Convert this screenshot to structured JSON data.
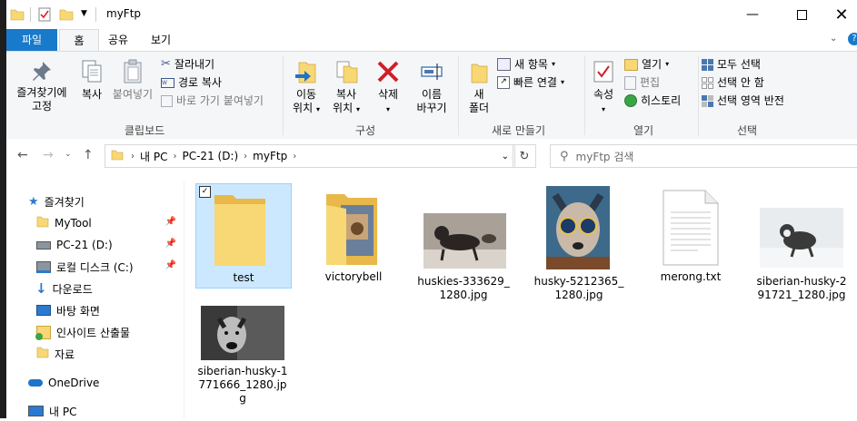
{
  "window": {
    "title": "myFtp",
    "minimize_icon": "minimize-icon",
    "maximize_icon": "maximize-icon",
    "close_icon": "close-icon"
  },
  "tabs": [
    {
      "label": "파일"
    },
    {
      "label": "홈"
    },
    {
      "label": "공유"
    },
    {
      "label": "보기"
    }
  ],
  "ribbon": {
    "clipboard": {
      "label": "클립보드",
      "pin": "즐겨찾기에 고정",
      "pin_line1": "즐겨찾기에",
      "pin_line2": "고정",
      "copy": "복사",
      "paste": "붙여넣기",
      "cut": "잘라내기",
      "copy_path": "경로 복사",
      "paste_shortcut": "바로 가기 붙여넣기"
    },
    "organize": {
      "label": "구성",
      "move_line1": "이동",
      "move_line2": "위치",
      "copy_line1": "복사",
      "copy_line2": "위치",
      "delete": "삭제",
      "rename_line1": "이름",
      "rename_line2": "바꾸기"
    },
    "new": {
      "label": "새로 만들기",
      "new_folder_line1": "새",
      "new_folder_line2": "폴더",
      "new_item": "새 항목",
      "easy_access": "빠른 연결"
    },
    "open": {
      "label": "열기",
      "properties": "속성",
      "open": "열기",
      "edit": "편집",
      "history": "히스토리"
    },
    "select": {
      "label": "선택",
      "select_all": "모두 선택",
      "select_none": "선택 안 함",
      "invert": "선택 영역 반전"
    }
  },
  "address": {
    "crumbs": [
      "내 PC",
      "PC-21 (D:)",
      "myFtp"
    ],
    "search_placeholder": "myFtp 검색"
  },
  "sidebar": {
    "items": [
      {
        "label": "즐겨찾기",
        "icon": "star-icon"
      },
      {
        "label": "MyTool",
        "icon": "folder-icon",
        "pinned": true
      },
      {
        "label": "PC-21 (D:)",
        "icon": "drive-icon",
        "pinned": true
      },
      {
        "label": "로컬 디스크 (C:)",
        "icon": "network-drive-icon",
        "pinned": true
      },
      {
        "label": "다운로드",
        "icon": "download-icon"
      },
      {
        "label": "바탕 화면",
        "icon": "desktop-icon"
      },
      {
        "label": "인사이트 산출물",
        "icon": "synced-folder-icon"
      },
      {
        "label": "자료",
        "icon": "folder-icon"
      },
      {
        "label": "OneDrive",
        "icon": "cloud-icon"
      },
      {
        "label": "내 PC",
        "icon": "pc-icon"
      }
    ]
  },
  "files": [
    {
      "name": "test",
      "type": "folder",
      "selected": true
    },
    {
      "name": "victorybell",
      "type": "folder-with-image"
    },
    {
      "name_lines": [
        "huskies-333629_",
        "1280.jpg"
      ],
      "type": "image"
    },
    {
      "name_lines": [
        "husky-5212365_",
        "1280.jpg"
      ],
      "type": "image"
    },
    {
      "name": "merong.txt",
      "type": "text"
    },
    {
      "name_lines": [
        "siberian-husky-2",
        "91721_1280.jpg"
      ],
      "type": "image"
    },
    {
      "name_lines": [
        "siberian-husky-1",
        "771666_1280.jp",
        "g"
      ],
      "type": "image"
    }
  ],
  "colors": {
    "file_tab": "#1979ca",
    "selection_bg": "#cce8ff",
    "selection_border": "#99d1ff",
    "folder": "#f8d775"
  }
}
